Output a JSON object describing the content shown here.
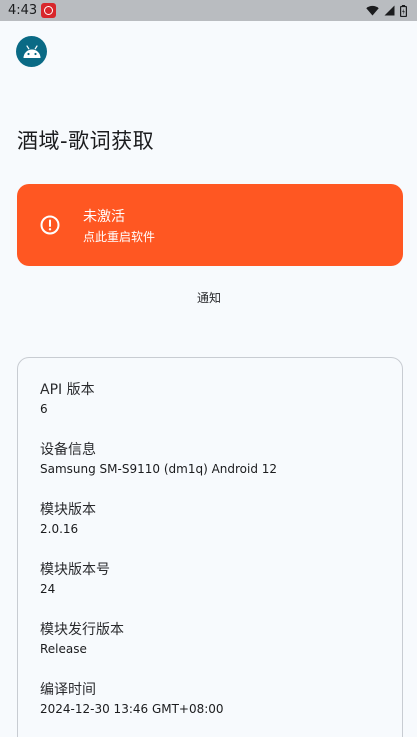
{
  "status_bar": {
    "time": "4:43",
    "icons": [
      "notification-app-icon",
      "wifi-icon",
      "signal-icon",
      "battery-icon"
    ]
  },
  "app": {
    "icon": "android-icon",
    "title": "酒域-歌词获取"
  },
  "activation": {
    "icon": "alert-circle-icon",
    "title": "未激活",
    "subtitle": "点此重启软件",
    "color": "#ff5722"
  },
  "notify_button": {
    "label": "通知"
  },
  "info": {
    "items": [
      {
        "label": "API 版本",
        "value": "6"
      },
      {
        "label": "设备信息",
        "value": "Samsung SM-S9110 (dm1q) Android 12"
      },
      {
        "label": "模块版本",
        "value": "2.0.16"
      },
      {
        "label": "模块版本号",
        "value": "24"
      },
      {
        "label": "模块发行版本",
        "value": "Release"
      },
      {
        "label": "编译时间",
        "value": "2024-12-30 13:46 GMT+08:00"
      }
    ]
  }
}
